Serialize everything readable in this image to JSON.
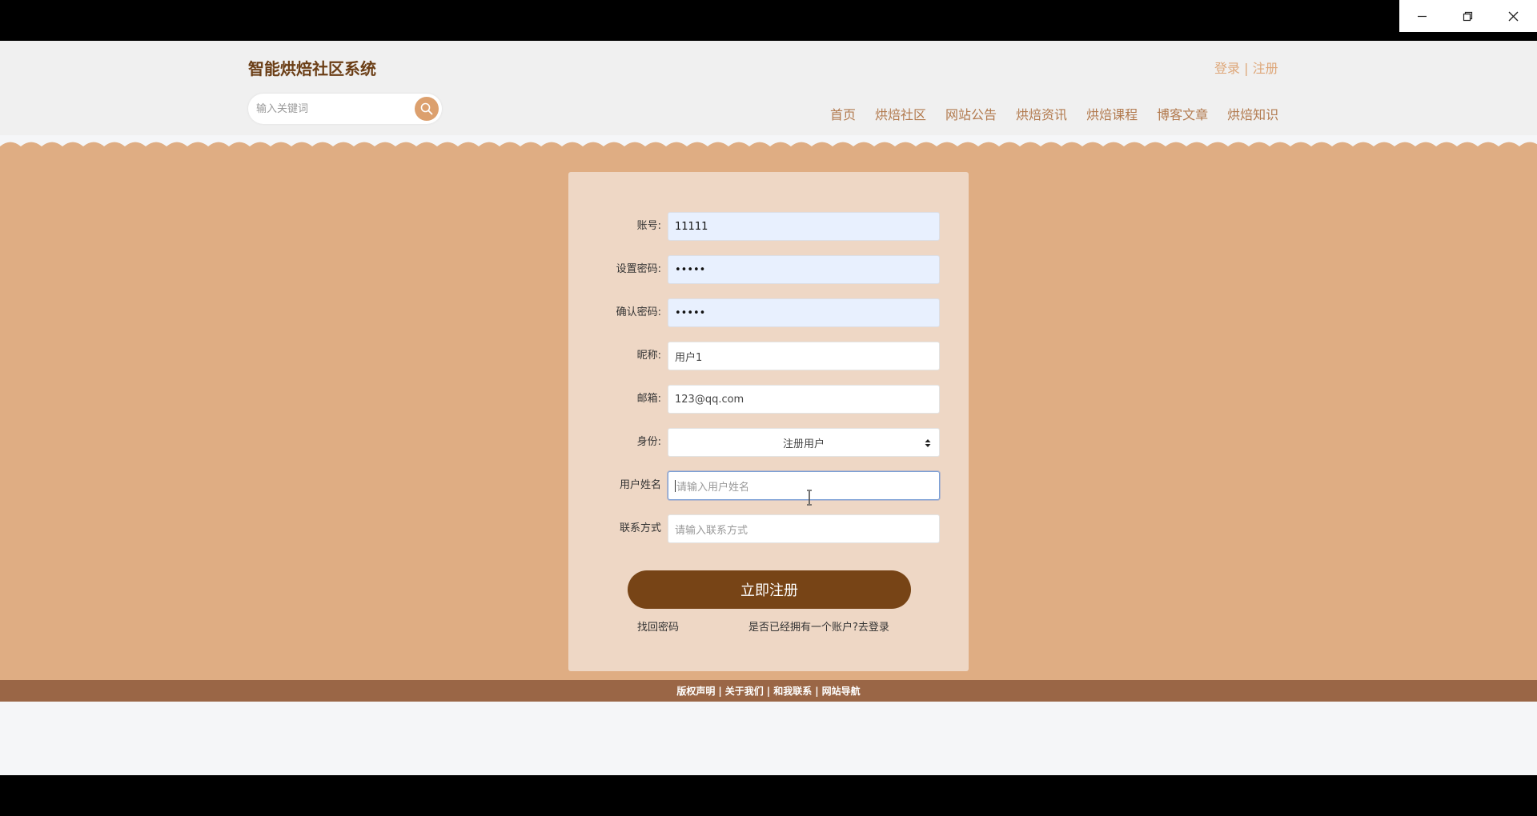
{
  "window": {
    "controls": [
      "minimize-icon",
      "restore-icon",
      "close-icon"
    ]
  },
  "header": {
    "brand": "智能烘焙社区系统",
    "auth": {
      "login": "登录",
      "separator": " | ",
      "register": "注册"
    },
    "search": {
      "placeholder": "输入关键词",
      "icon": "search-icon"
    },
    "nav": [
      "首页",
      "烘焙社区",
      "网站公告",
      "烘焙资讯",
      "烘焙课程",
      "博客文章",
      "烘焙知识"
    ]
  },
  "form": {
    "account": {
      "label": "账号:",
      "value": "11111"
    },
    "password": {
      "label": "设置密码:",
      "value": "•••••"
    },
    "confirm": {
      "label": "确认密码:",
      "value": "•••••"
    },
    "nickname": {
      "label": "昵称:",
      "value": "用户1"
    },
    "email": {
      "label": "邮箱:",
      "value": "123@qq.com"
    },
    "role": {
      "label": "身份:",
      "value": "注册用户"
    },
    "realname": {
      "label": "用户姓名",
      "placeholder": "请输入用户姓名"
    },
    "contact": {
      "label": "联系方式",
      "placeholder": "请输入联系方式"
    },
    "submit": "立即注册",
    "find_password": "找回密码",
    "have_account": "是否已经拥有一个账户?去登录"
  },
  "footer": {
    "links": [
      "版权声明",
      "关于我们",
      "和我联系",
      "网站导航"
    ],
    "separator": "|"
  },
  "colors": {
    "brand": "#6b3e16",
    "accent": "#dca06e",
    "main_bg": "#dfad83",
    "card_bg": "#eed7c5",
    "button": "#774416",
    "footer": "#9a6646"
  }
}
